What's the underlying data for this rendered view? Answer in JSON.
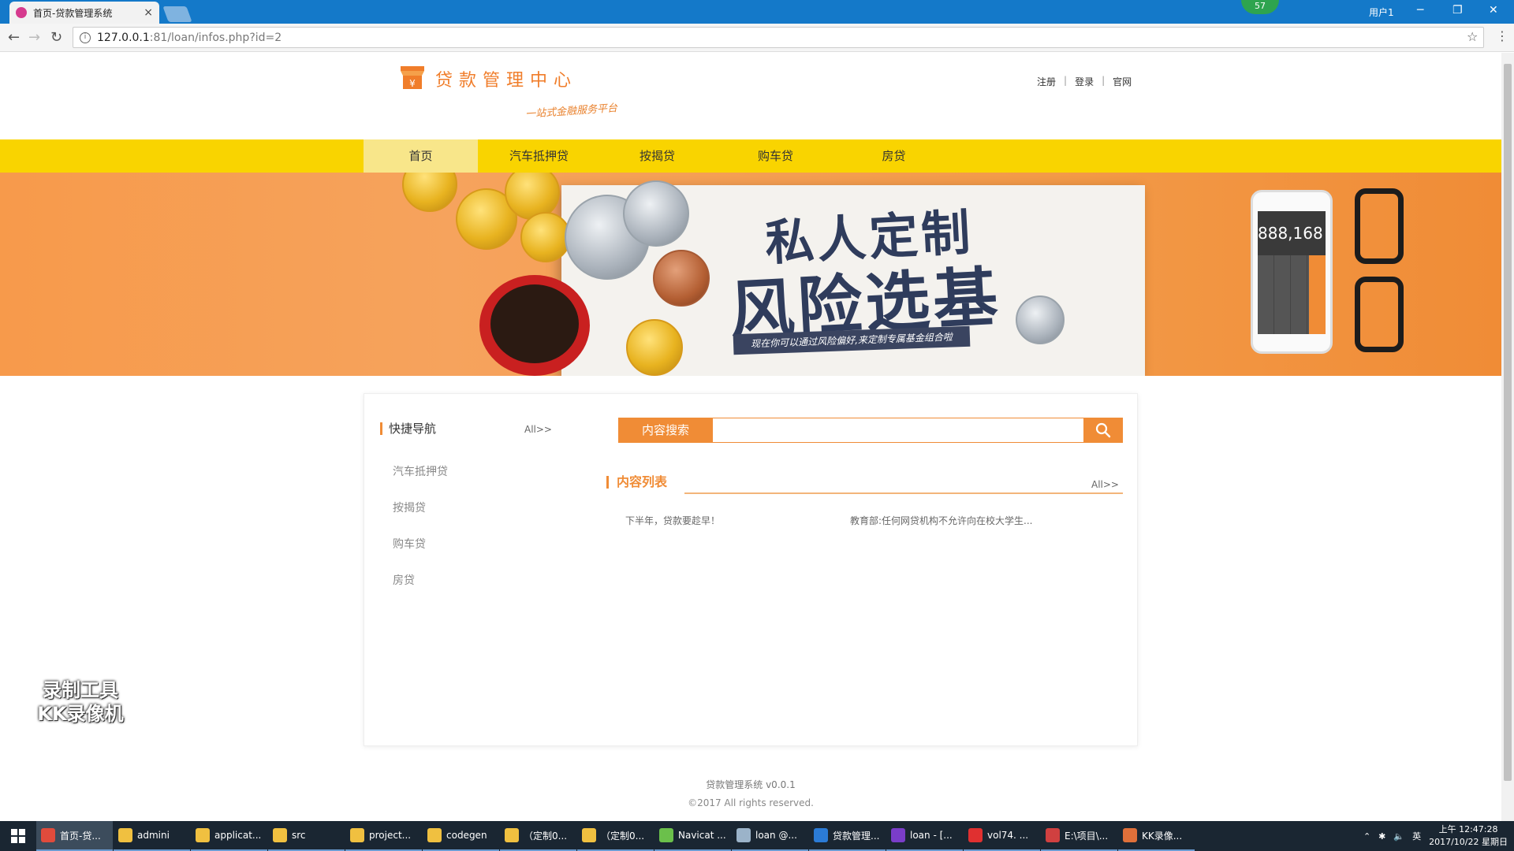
{
  "browser": {
    "tab_title": "首页-贷款管理系统",
    "tab_close": "×",
    "badge": "57",
    "window_user": "用户1",
    "url_host": "127.0.0.1",
    "url_path": ":81/loan/infos.php?id=2",
    "controls": {
      "minimize": "─",
      "restore": "❐",
      "close": "✕"
    },
    "back": "←",
    "forward": "→",
    "reload": "↻",
    "star": "☆",
    "menu": "⋮",
    "info": "i"
  },
  "header": {
    "logo_title": "贷款管理中心",
    "logo_slogan": "一站式金融服务平台",
    "links": {
      "register": "注册",
      "login": "登录",
      "official": "官网",
      "sep": "|"
    }
  },
  "nav": {
    "items": [
      {
        "label": "首页",
        "active": true
      },
      {
        "label": "汽车抵押贷",
        "active": false
      },
      {
        "label": "按揭贷",
        "active": false
      },
      {
        "label": "购车贷",
        "active": false
      },
      {
        "label": "房贷",
        "active": false
      }
    ]
  },
  "banner": {
    "title1": "私人定制",
    "title2": "风险选基",
    "ribbon": "现在你可以通过风险偏好,来定制专属基金组合啦",
    "phone_display": "888,168"
  },
  "sidebar": {
    "title": "快捷导航",
    "all": "All>>",
    "items": [
      "汽车抵押贷",
      "按揭贷",
      "购车贷",
      "房贷"
    ]
  },
  "search": {
    "button_label": "内容搜索",
    "value": "",
    "placeholder": ""
  },
  "content_list": {
    "title": "内容列表",
    "all": "All>>",
    "items": [
      "下半年，贷款要趁早！",
      "教育部:任何网贷机构不允许向在校大学生..."
    ]
  },
  "footer": {
    "version": "贷款管理系统 v0.0.1",
    "copyright": "©2017 All rights reserved."
  },
  "watermark": {
    "line1": "录制工具",
    "line2": "KK录像机"
  },
  "taskbar": {
    "tasks": [
      {
        "label": "首页-贷...",
        "color": "#e04b3c",
        "active": true
      },
      {
        "label": "admini",
        "color": "#f0c040",
        "active": false
      },
      {
        "label": "applicat...",
        "color": "#f0c040",
        "active": false
      },
      {
        "label": "src",
        "color": "#f0c040",
        "active": false
      },
      {
        "label": "project...",
        "color": "#f0c040",
        "active": false
      },
      {
        "label": "codegen",
        "color": "#f0c040",
        "active": false
      },
      {
        "label": "（定制0...",
        "color": "#f0c040",
        "active": false
      },
      {
        "label": "（定制0...",
        "color": "#f0c040",
        "active": false
      },
      {
        "label": "Navicat ...",
        "color": "#6bc04b",
        "active": false
      },
      {
        "label": "loan @...",
        "color": "#9bb3c9",
        "active": false
      },
      {
        "label": "贷款管理...",
        "color": "#2b7bd6",
        "active": false
      },
      {
        "label": "loan - [...",
        "color": "#7a3dc9",
        "active": false
      },
      {
        "label": "vol74. ...",
        "color": "#e03030",
        "active": false
      },
      {
        "label": "E:\\项目\\...",
        "color": "#d04040",
        "active": false
      },
      {
        "label": "KK录像...",
        "color": "#e0703a",
        "active": false
      }
    ],
    "ime": "英",
    "time": "上午 12:47:28",
    "date": "2017/10/22 星期日"
  }
}
